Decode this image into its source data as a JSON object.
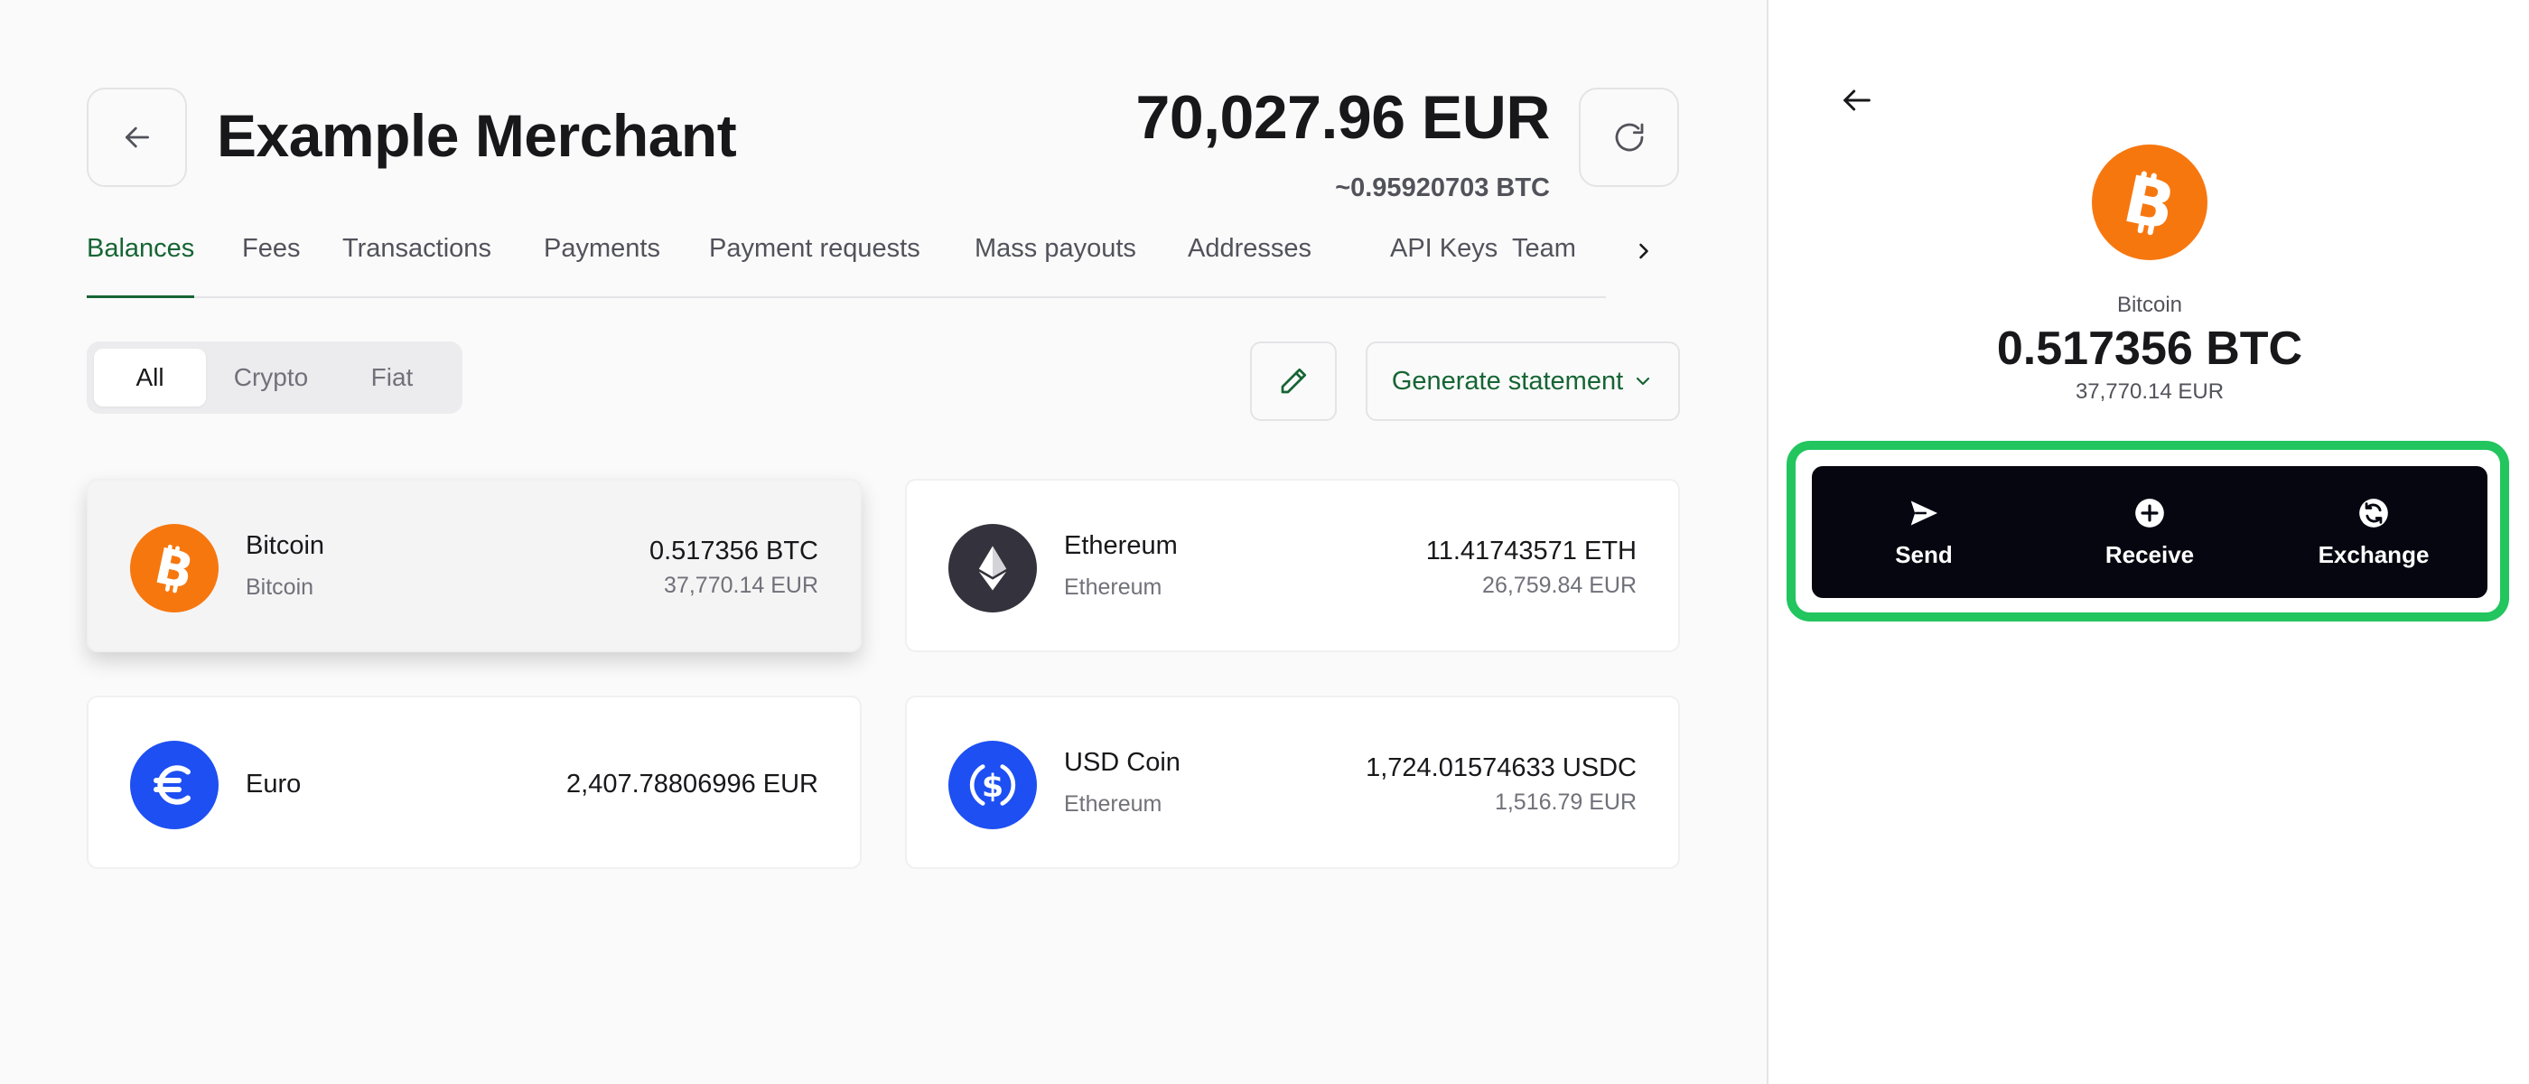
{
  "header": {
    "title": "Example Merchant",
    "total_amount": "70,027.96 EUR",
    "total_btc": "~0.95920703 BTC"
  },
  "tabs": [
    {
      "label": "Balances",
      "active": true
    },
    {
      "label": "Fees"
    },
    {
      "label": "Transactions"
    },
    {
      "label": "Payments"
    },
    {
      "label": "Payment requests"
    },
    {
      "label": "Mass payouts"
    },
    {
      "label": "Addresses"
    },
    {
      "label": "API Keys"
    },
    {
      "label": "Team"
    }
  ],
  "filters": [
    {
      "label": "All",
      "active": true
    },
    {
      "label": "Crypto"
    },
    {
      "label": "Fiat"
    }
  ],
  "generate_statement_label": "Generate statement",
  "balances": [
    {
      "name": "Bitcoin",
      "network": "Bitcoin",
      "amount": "0.517356 BTC",
      "fiat": "37,770.14 EUR",
      "icon": "bitcoin-icon",
      "color": "#f7770f",
      "selected": true
    },
    {
      "name": "Ethereum",
      "network": "Ethereum",
      "amount": "11.41743571 ETH",
      "fiat": "26,759.84 EUR",
      "icon": "ethereum-icon",
      "color": "#34333d"
    },
    {
      "name": "Euro",
      "amount": "2,407.78806996 EUR",
      "icon": "euro-icon",
      "color": "#1d4ff2"
    },
    {
      "name": "USD Coin",
      "network": "Ethereum",
      "amount": "1,724.01574633 USDC",
      "fiat": "1,516.79 EUR",
      "icon": "usdc-icon",
      "color": "#1d4ff2"
    }
  ],
  "side_panel": {
    "asset_name": "Bitcoin",
    "amount": "0.517356 BTC",
    "fiat": "37,770.14 EUR",
    "actions": [
      {
        "label": "Send",
        "icon": "send-icon"
      },
      {
        "label": "Receive",
        "icon": "plus-circle-icon"
      },
      {
        "label": "Exchange",
        "icon": "exchange-icon"
      }
    ],
    "highlight_color": "#22c55e"
  },
  "colors": {
    "accent_green": "#166534",
    "bitcoin_orange": "#f7770f",
    "action_bar": "#060611"
  }
}
